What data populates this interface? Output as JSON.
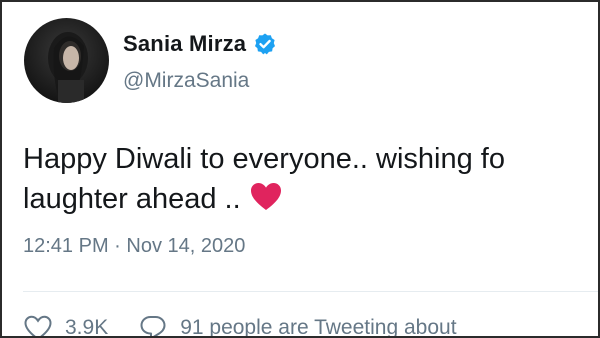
{
  "tweet": {
    "display_name": "Sania Mirza",
    "handle": "@MirzaSania",
    "text_line1": "Happy Diwali to everyone.. wishing fo",
    "text_line2": "laughter ahead ..",
    "timestamp": "12:41 PM · Nov 14, 2020",
    "likes": "3.9K",
    "tweeting_about": "91 people are Tweeting about"
  },
  "icons": {
    "verified": "verified-badge-icon",
    "heart_emoji": "red-heart-emoji",
    "like": "heart-outline-icon",
    "reply": "speech-bubble-icon"
  },
  "colors": {
    "verified": "#1da1f2",
    "heart": "#e0245e",
    "text": "#14171a",
    "secondary": "#657786"
  }
}
